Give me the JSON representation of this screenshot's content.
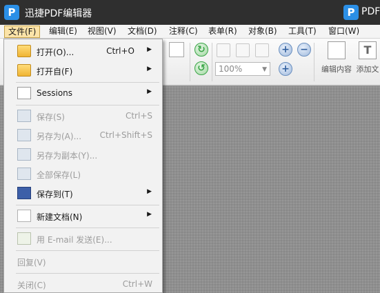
{
  "window": {
    "title": "迅捷PDF编辑器",
    "right_title": "PDF",
    "logo_letter": "P"
  },
  "menu": [
    {
      "label": "文件(F)"
    },
    {
      "label": "编辑(E)"
    },
    {
      "label": "视图(V)"
    },
    {
      "label": "文档(D)"
    },
    {
      "label": "注释(C)"
    },
    {
      "label": "表单(R)"
    },
    {
      "label": "对象(B)"
    },
    {
      "label": "工具(T)"
    },
    {
      "label": "窗口(W)"
    }
  ],
  "toolbar": {
    "zoom_value": "100%",
    "edit_content_label": "编辑内容",
    "add_text_label": "添加文"
  },
  "file_menu": [
    {
      "label": "打开(O)...",
      "shortcut": "Ctrl+O"
    },
    {
      "label": "打开自(F)"
    },
    {
      "label": "Sessions"
    },
    {
      "label": "保存(S)",
      "shortcut": "Ctrl+S"
    },
    {
      "label": "另存为(A)...",
      "shortcut": "Ctrl+Shift+S"
    },
    {
      "label": "另存为副本(Y)..."
    },
    {
      "label": "全部保存(L)"
    },
    {
      "label": "保存到(T)"
    },
    {
      "label": "新建文档(N)"
    },
    {
      "label": "用 E-mail 发送(E)..."
    },
    {
      "label": "回复(V)"
    },
    {
      "label": "关闭(C)",
      "shortcut": "Ctrl+W"
    }
  ],
  "icons": {
    "submenu_arrow": "▶"
  },
  "colors": {
    "titlebar": "#2f2f2f",
    "menu_active": "#fbe3a8",
    "accent": "#2b8fe6"
  }
}
